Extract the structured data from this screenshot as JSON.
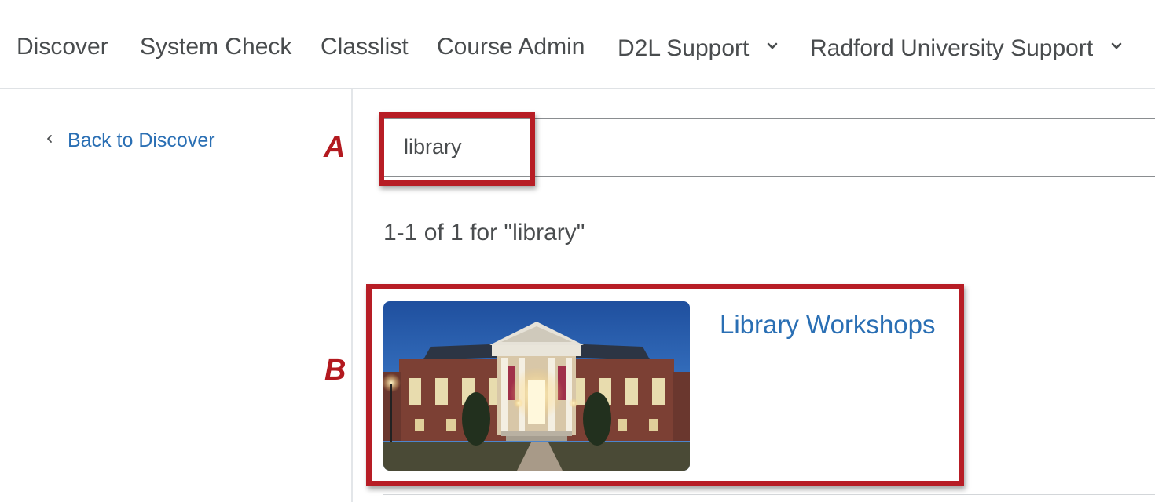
{
  "nav": {
    "items": [
      {
        "label": "Discover"
      },
      {
        "label": "System Check"
      },
      {
        "label": "Classlist"
      },
      {
        "label": "Course Admin"
      },
      {
        "label": "D2L Support",
        "has_dropdown": true
      },
      {
        "label": "Radford University Support",
        "has_dropdown": true
      }
    ]
  },
  "sidebar": {
    "back_label": "Back to Discover",
    "back_icon": "chevron-left-icon"
  },
  "search": {
    "value": "library"
  },
  "results": {
    "count_text": "1-1 of 1 for \"library\"",
    "items": [
      {
        "title": "Library Workshops",
        "image": "library-building-photo"
      }
    ]
  },
  "annotations": {
    "a_label": "A",
    "b_label": "B",
    "color": "#b71d25"
  },
  "colors": {
    "link": "#2a6fb4",
    "text": "#494c4e"
  }
}
